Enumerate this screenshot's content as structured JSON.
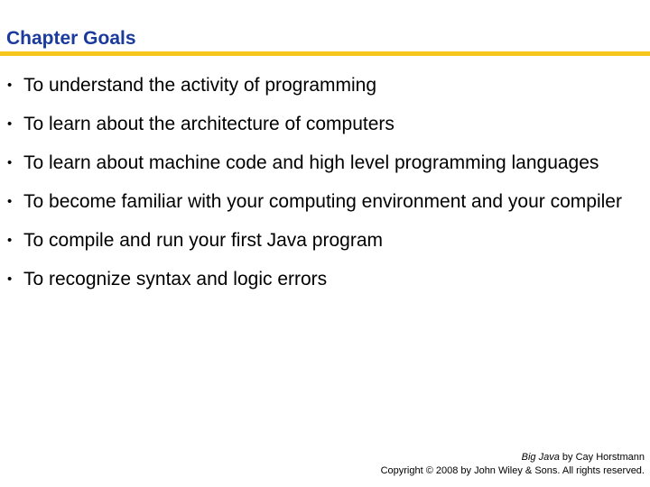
{
  "slide": {
    "title": "Chapter Goals",
    "colors": {
      "title": "#1a3a9c",
      "rule": "#f6c61c",
      "text": "#000000"
    },
    "bullet_glyph": "•",
    "goals": [
      {
        "text": "To understand the activity of programming"
      },
      {
        "text": "To learn about the architecture of computers"
      },
      {
        "text": "To learn about machine code and high level programming languages"
      },
      {
        "text": "To become familiar with your computing environment and your compiler"
      },
      {
        "text": "To compile and run your first Java program"
      },
      {
        "text": "To recognize syntax and logic errors"
      }
    ]
  },
  "footer": {
    "book_title": "Big Java",
    "byline": " by Cay Horstmann",
    "copyright": "Copyright © 2008 by John Wiley & Sons.  All rights reserved."
  }
}
